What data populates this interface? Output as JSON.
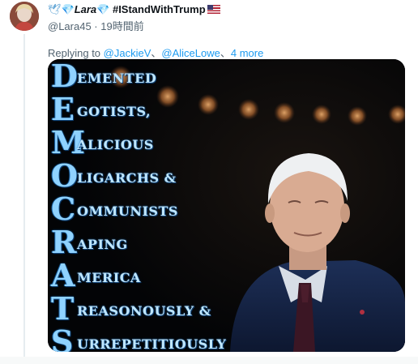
{
  "tweet": {
    "display_name_prefix": "🕊💎",
    "display_name_main": "Lara",
    "display_name_suffix": "💎 #IStandWithTrump",
    "handle": "@Lara45",
    "separator": " · ",
    "timestamp": "19時間前",
    "replying_to_label": "Replying to ",
    "reply_user_1": "@JackieV",
    "reply_sep_1": "、",
    "reply_user_2": "@AliceLowe",
    "reply_sep_2": "、",
    "reply_more": "4 more"
  },
  "image": {
    "acrostic": [
      {
        "letter": "D",
        "rest": "EMENTED"
      },
      {
        "letter": "E",
        "rest": "GOTISTS,"
      },
      {
        "letter": "M",
        "rest": "ALICIOUS"
      },
      {
        "letter": "O",
        "rest": "LIGARCHS &"
      },
      {
        "letter": "C",
        "rest": "OMMUNISTS"
      },
      {
        "letter": "R",
        "rest": "APING"
      },
      {
        "letter": "A",
        "rest": "MERICA"
      },
      {
        "letter": "T",
        "rest": "REASONOUSLY &"
      },
      {
        "letter": "S",
        "rest": "URREPETITIOUSLY"
      }
    ]
  },
  "colors": {
    "link": "#1d9bf0",
    "muted": "#536471",
    "acrostic_text": "#8fd2ff"
  }
}
